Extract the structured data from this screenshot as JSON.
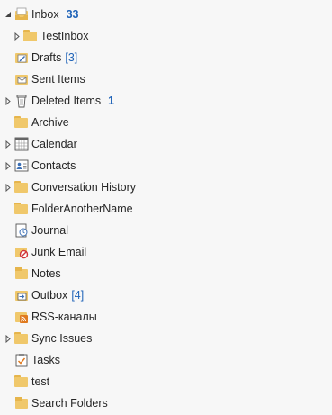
{
  "folders": [
    {
      "label": "Inbox",
      "count": "33",
      "count_style": "bold"
    },
    {
      "label": "TestInbox"
    },
    {
      "label": "Drafts",
      "count": "[3]",
      "count_style": "bracket"
    },
    {
      "label": "Sent Items"
    },
    {
      "label": "Deleted Items",
      "count": "1",
      "count_style": "bold"
    },
    {
      "label": "Archive"
    },
    {
      "label": "Calendar"
    },
    {
      "label": "Contacts"
    },
    {
      "label": "Conversation History"
    },
    {
      "label": "FolderAnotherName"
    },
    {
      "label": "Journal"
    },
    {
      "label": "Junk Email"
    },
    {
      "label": "Notes"
    },
    {
      "label": "Outbox",
      "count": "[4]",
      "count_style": "bracket"
    },
    {
      "label": "RSS-каналы"
    },
    {
      "label": "Sync Issues"
    },
    {
      "label": "Tasks"
    },
    {
      "label": "test"
    },
    {
      "label": "Search Folders"
    }
  ],
  "icons": {
    "inbox": "inbox-icon",
    "folder": "folder-icon",
    "drafts": "drafts-icon",
    "sent": "sent-items-icon",
    "deleted": "trash-icon",
    "calendar": "calendar-icon",
    "contacts": "contacts-icon",
    "journal": "journal-icon",
    "junk": "junk-email-icon",
    "notes": "notes-icon",
    "outbox": "outbox-icon",
    "rss": "rss-icon",
    "tasks": "tasks-icon",
    "search": "search-folder-icon"
  },
  "colors": {
    "count": "#1f63b8",
    "folder": "#f0c86b",
    "folder_tab": "#e6b54c",
    "text": "#262626",
    "background": "#f7f7f7"
  }
}
